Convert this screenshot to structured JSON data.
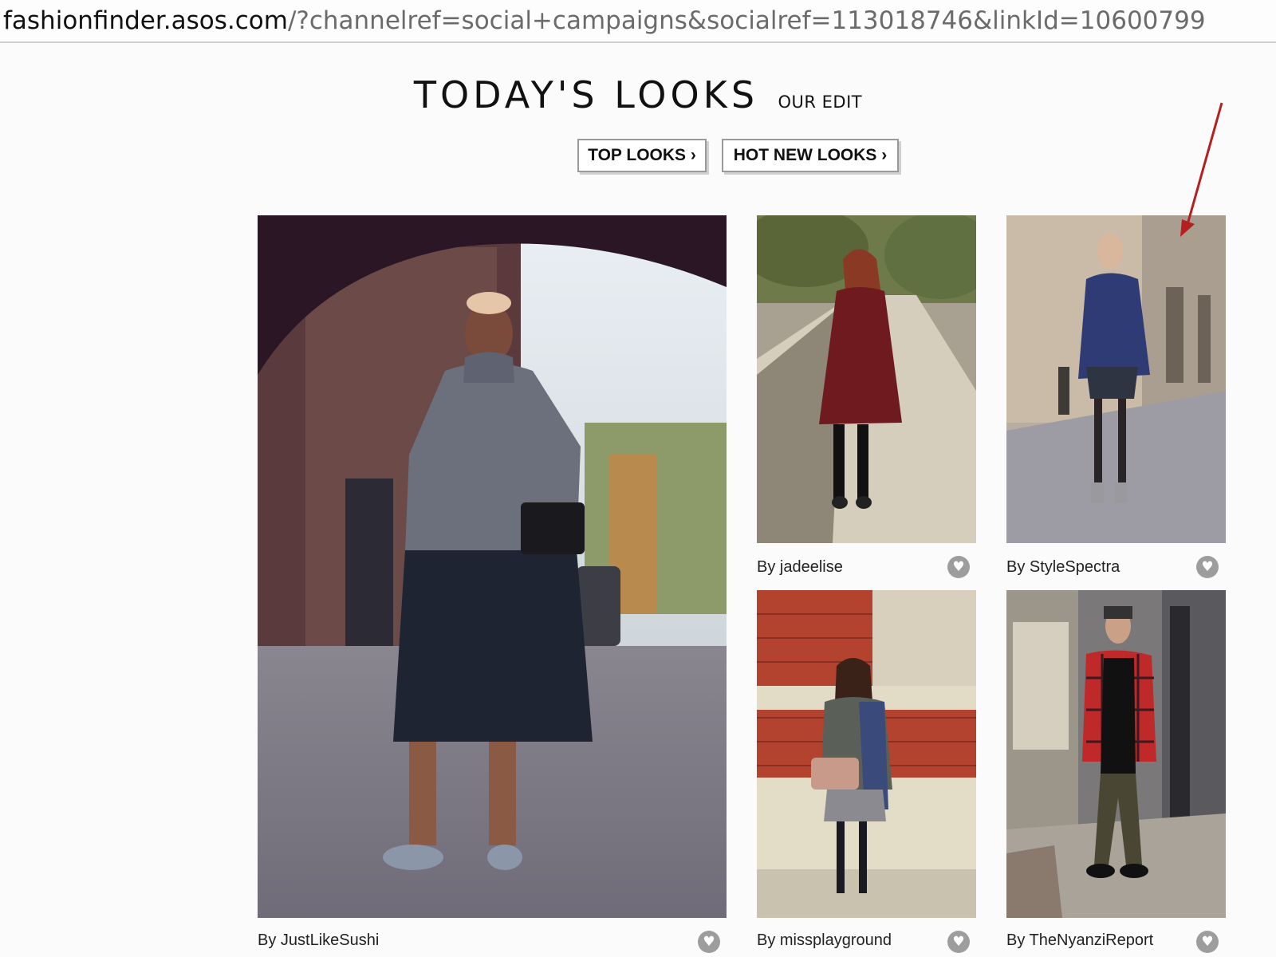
{
  "browser": {
    "url_host": "fashionfinder.asos.com",
    "url_path": "/?channelref=social+campaigns&socialref=113018746&linkId=10600799"
  },
  "header": {
    "title": "TODAY'S LOOKS",
    "subtitle": "OUR EDIT",
    "buttons": [
      "TOP LOOKS ›",
      "HOT NEW LOOKS ›"
    ]
  },
  "looks": [
    {
      "author": "By JustLikeSushi"
    },
    {
      "author": "By jadeelise"
    },
    {
      "author": "By StyleSpectra"
    },
    {
      "author": "By missplayground"
    },
    {
      "author": "By TheNyanziReport"
    }
  ],
  "icons": {
    "like": "heart-icon",
    "annotation": "red-arrow-icon"
  },
  "colors": {
    "annotation_arrow": "#b51f1f",
    "like_button": "#9d9d9d"
  }
}
